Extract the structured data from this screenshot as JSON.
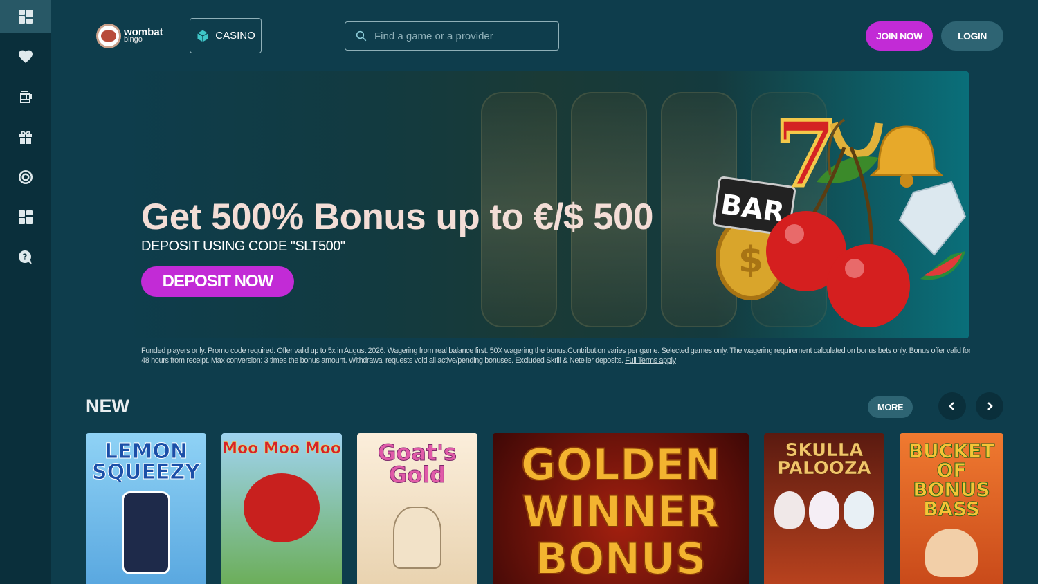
{
  "sidebar": {
    "items": [
      {
        "name": "dashboard",
        "icon": "grid-icon",
        "active": true
      },
      {
        "name": "favourites",
        "icon": "heart-icon",
        "active": false
      },
      {
        "name": "slots",
        "icon": "slot-machine-icon",
        "active": false
      },
      {
        "name": "promotions",
        "icon": "gift-icon",
        "active": false
      },
      {
        "name": "live",
        "icon": "target-icon",
        "active": false
      },
      {
        "name": "categories",
        "icon": "tiles-icon",
        "active": false
      },
      {
        "name": "help",
        "icon": "help-chat-icon",
        "active": false
      }
    ]
  },
  "header": {
    "logo": {
      "line1": "wombat",
      "line2": "bingo"
    },
    "casino_label": "CASINO",
    "search_placeholder": "Find a game or a provider",
    "join_label": "JOIN NOW",
    "login_label": "LOGIN"
  },
  "banner": {
    "title": "Get 500% Bonus up to €/$ 500",
    "subtitle": "DEPOSIT USING CODE \"SLT500\"",
    "cta": "DEPOSIT NOW",
    "image_label": "BAR"
  },
  "terms": {
    "text": "Funded players only. Promo code required. Offer valid up to 5x in August 2026. Wagering from real balance first. 50X wagering the bonus.Contribution varies per game. Selected games only. The wagering requirement calculated on bonus bets only. Bonus offer valid for 48 hours from receipt. Max conversion: 3 times the bonus amount. Withdrawal requests void all active/pending bonuses. Excluded Skrill & Neteller deposits.",
    "link": "Full Terms apply"
  },
  "new_section": {
    "title": "NEW",
    "more_label": "MORE",
    "games": [
      {
        "title": "LEMON SQUEEZY",
        "bg": "#7fc6ee",
        "color": "#1b4fa8"
      },
      {
        "title": "Moo Moo Moo",
        "bg": "#8ec7e6",
        "color": "#d4222b"
      },
      {
        "title": "Goat's Gold",
        "bg": "#f4e4c9",
        "color": "#e05aa8"
      },
      {
        "title": "GOLDEN WINNER BONUS",
        "bg": "#5a0d08",
        "color": "#f3b430"
      },
      {
        "title": "SKULLA PALOOZA",
        "bg": "#8a2a1a",
        "color": "#f1c56a"
      },
      {
        "title": "BUCKET OF BONUS BASS",
        "bg": "#e0682a",
        "color": "#f6c436"
      }
    ]
  },
  "colors": {
    "background": "#0e3d4c",
    "sidebar": "#0a2f3b",
    "accent": "#c22bd6",
    "secondary_button": "#2e6473"
  }
}
